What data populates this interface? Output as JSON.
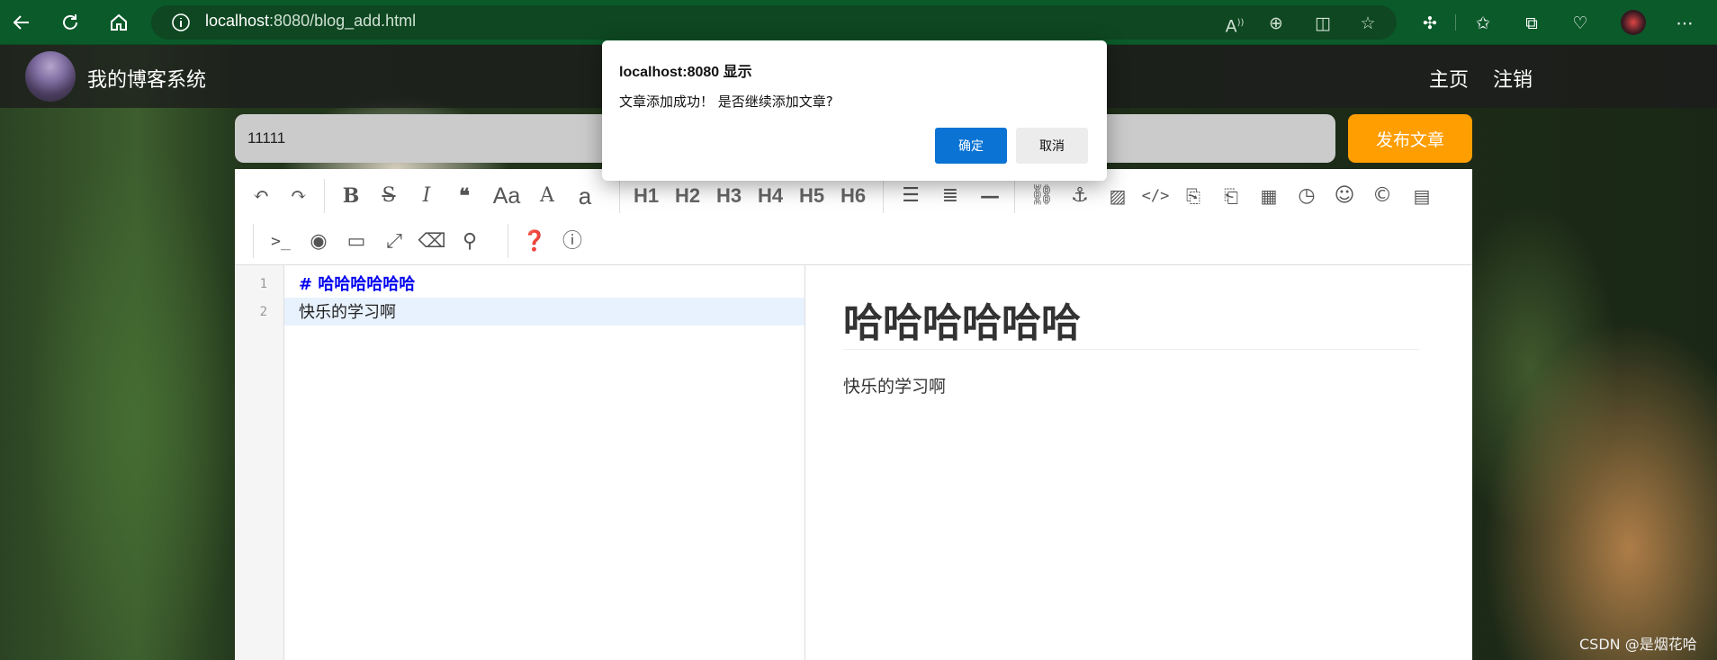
{
  "browser": {
    "url_host": "localhost",
    "url_path": ":8080/blog_add.html"
  },
  "navbar": {
    "site_title": "我的博客系统",
    "links": [
      {
        "label": "主页"
      },
      {
        "label": "注销"
      }
    ]
  },
  "editor_header": {
    "title_value": "11111",
    "publish_label": "发布文章"
  },
  "toolbar": {
    "headings": [
      "H1",
      "H2",
      "H3",
      "H4",
      "H5",
      "H6"
    ],
    "case_label": "Aa",
    "font_a": "A",
    "font_a_lower": "a"
  },
  "code": {
    "line_numbers": [
      "1",
      "2"
    ],
    "line1": "#  哈哈哈哈哈哈",
    "line2": "快乐的学习啊"
  },
  "preview": {
    "heading": "哈哈哈哈哈哈",
    "paragraph": "快乐的学习啊"
  },
  "dialog": {
    "title": "localhost:8080 显示",
    "message": "文章添加成功！ 是否继续添加文章?",
    "ok_label": "确定",
    "cancel_label": "取消"
  },
  "watermark": "CSDN @是烟花哈",
  "colors": {
    "publish_button": "#ff9e00",
    "dialog_ok": "#0a73d3",
    "browser_bar": "#0b5a2a",
    "markdown_heading": "#0000ee"
  }
}
